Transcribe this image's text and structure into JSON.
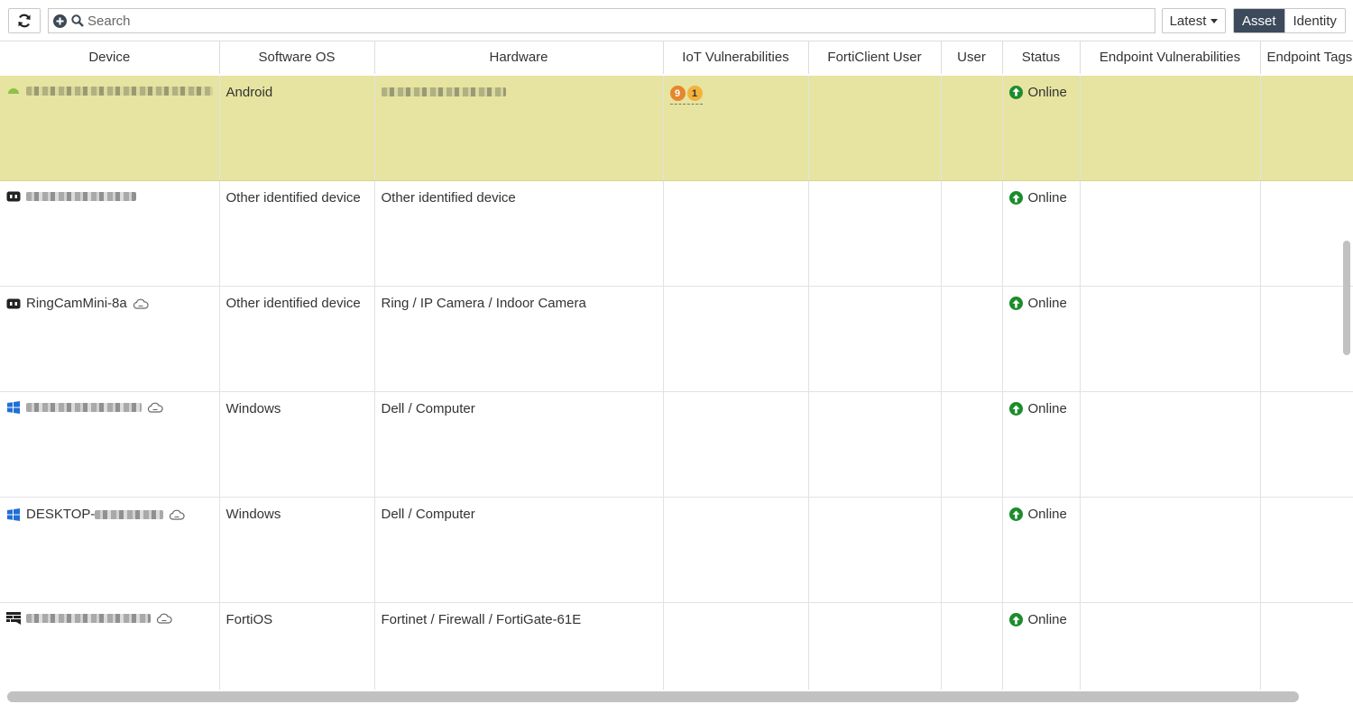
{
  "toolbar": {
    "search_placeholder": "Search",
    "latest_label": "Latest",
    "view_tabs": [
      {
        "label": "Asset",
        "active": true
      },
      {
        "label": "Identity",
        "active": false
      }
    ]
  },
  "table": {
    "columns": [
      "Device",
      "Software OS",
      "Hardware",
      "IoT Vulnerabilities",
      "FortiClient User",
      "User",
      "Status",
      "Endpoint Vulnerabilities",
      "Endpoint Tags"
    ],
    "rows": [
      {
        "device": "",
        "device_icon": "android-icon",
        "software_os": "Android",
        "hardware": "",
        "iot_vulnerabilities": {
          "high": "9",
          "medium": "1"
        },
        "status": "Online",
        "highlighted": true
      },
      {
        "device": "",
        "device_icon": "device-icon",
        "software_os": "Other identified device",
        "hardware": "Other identified device",
        "status": "Online"
      },
      {
        "device": "RingCamMini-8a",
        "device_icon": "device-icon",
        "software_os": "Other identified device",
        "hardware": "Ring / IP Camera / Indoor Camera",
        "status": "Online"
      },
      {
        "device": "",
        "device_icon": "windows-icon",
        "software_os": "Windows",
        "hardware": "Dell / Computer",
        "status": "Online"
      },
      {
        "device": "DESKTOP-",
        "device_icon": "windows-icon",
        "software_os": "Windows",
        "hardware": "Dell / Computer",
        "status": "Online"
      },
      {
        "device": "",
        "device_icon": "firewall-icon",
        "software_os": "FortiOS",
        "hardware": "Fortinet / Firewall / FortiGate-61E",
        "status": "Online"
      }
    ]
  },
  "colors": {
    "highlight_row": "#e6e4a0",
    "online": "#1d8c2c",
    "active_tab": "#3d4a5c",
    "vuln_high": "#e8862c",
    "vuln_medium": "#f4b23c"
  }
}
